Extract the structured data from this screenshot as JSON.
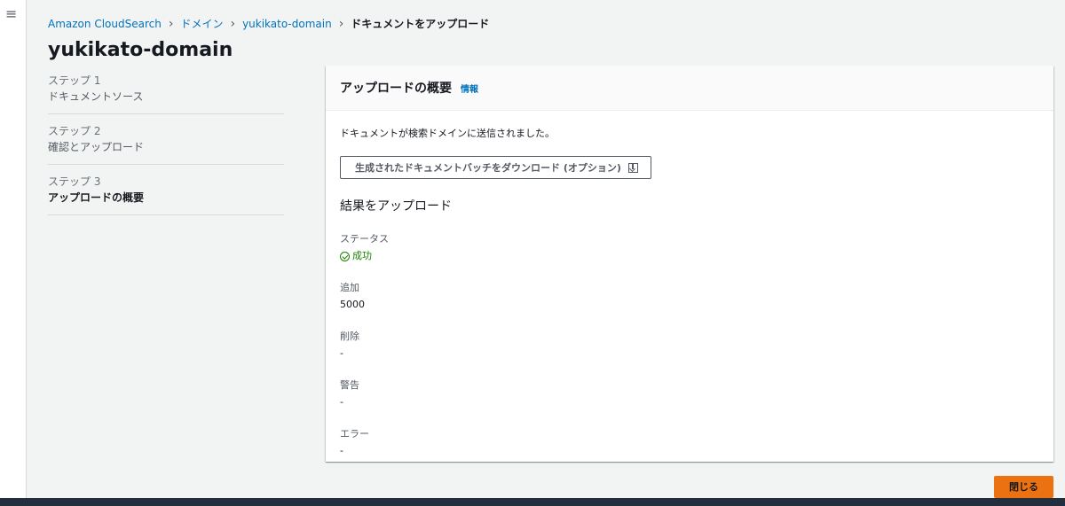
{
  "nav": {
    "menu_icon": "≡"
  },
  "breadcrumb": {
    "items": [
      "Amazon CloudSearch",
      "ドメイン",
      "yukikato-domain"
    ],
    "current": "ドキュメントをアップロード"
  },
  "page": {
    "title": "yukikato-domain"
  },
  "steps": [
    {
      "num": "ステップ 1",
      "label": "ドキュメントソース"
    },
    {
      "num": "ステップ 2",
      "label": "確認とアップロード"
    },
    {
      "num": "ステップ 3",
      "label": "アップロードの概要"
    }
  ],
  "panel": {
    "title": "アップロードの概要",
    "info": "情報",
    "message": "ドキュメントが検索ドメインに送信されました。",
    "download_button": "生成されたドキュメントバッチをダウンロード (オプション)",
    "results_title": "結果をアップロード",
    "results": {
      "status_label": "ステータス",
      "status_value": "成功",
      "added_label": "追加",
      "added_value": "5000",
      "deleted_label": "削除",
      "deleted_value": "-",
      "warnings_label": "警告",
      "warnings_value": "-",
      "errors_label": "エラー",
      "errors_value": "-"
    }
  },
  "actions": {
    "close_label": "閉じる"
  },
  "colors": {
    "primary": "#ec7211",
    "link": "#0073bb",
    "success": "#1d8102",
    "footer": "#232f3e"
  }
}
